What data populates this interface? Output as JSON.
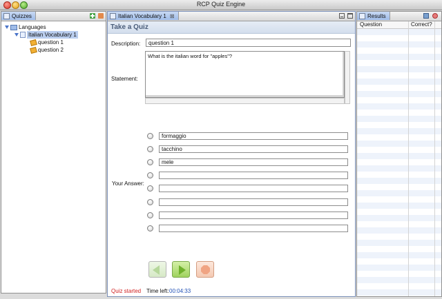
{
  "window": {
    "title": "RCP Quiz Engine"
  },
  "quizzes_view": {
    "tab_label": "Quizzes",
    "tree": {
      "root": "Languages",
      "quiz": "Italian Vocabulary 1",
      "questions": [
        "question 1",
        "question 2"
      ]
    }
  },
  "editor": {
    "tab_label": "Italian Vocabulary 1",
    "heading": "Take a Quiz",
    "description_label": "Description:",
    "description_value": "question 1",
    "statement_label": "Statement:",
    "statement_value": "What is the italian word for \"apples\"?",
    "answer_label": "Your Answer:",
    "answers": [
      "formaggio",
      "tacchino",
      "mele",
      "",
      "",
      "",
      "",
      ""
    ],
    "status": "Quiz started",
    "time_left_label": "Time left:",
    "time_left_value": "00:04:33"
  },
  "results_view": {
    "tab_label": "Results",
    "columns": [
      "Question",
      "Correct?"
    ]
  },
  "colors": {
    "status_red": "#d02020",
    "time_blue": "#1f4fb5",
    "selection": "#b9cdee"
  }
}
